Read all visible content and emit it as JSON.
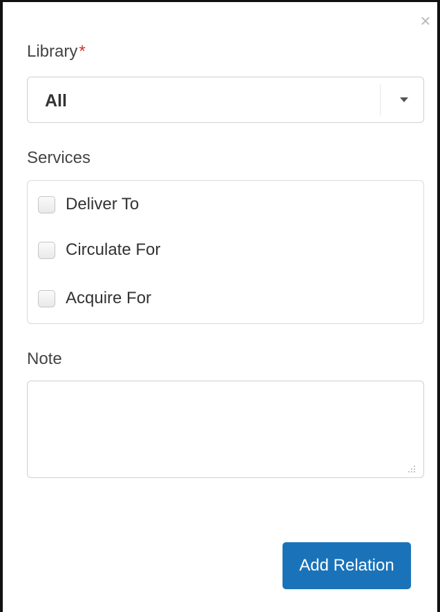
{
  "dialog": {
    "close_glyph": "×",
    "library": {
      "label": "Library",
      "required_marker": "*",
      "selected_value": "All"
    },
    "services": {
      "label": "Services",
      "options": [
        {
          "label": "Deliver To",
          "checked": false
        },
        {
          "label": "Circulate For",
          "checked": false
        },
        {
          "label": "Acquire For",
          "checked": false
        }
      ]
    },
    "note": {
      "label": "Note",
      "value": ""
    },
    "submit_label": "Add Relation"
  },
  "colors": {
    "primary_button": "#1a73b9",
    "required": "#d32f2f"
  }
}
